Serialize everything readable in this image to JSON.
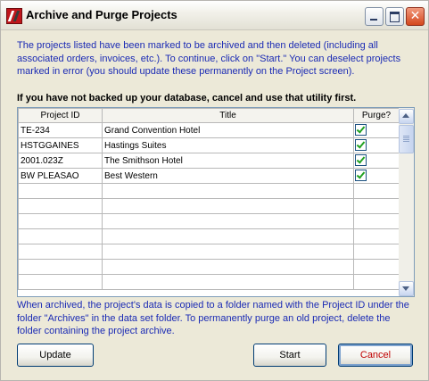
{
  "window": {
    "title": "Archive and Purge Projects"
  },
  "intro_text": "The projects listed have been marked to be archived and then deleted (including all associated orders, invoices, etc.). To continue, click on \"Start.\" You can deselect projects marked in error (you should update these permanently on the Project screen).",
  "warning_text": "If you have not backed up your database, cancel and use that utility first.",
  "grid": {
    "columns": [
      "Project ID",
      "Title",
      "Purge?"
    ],
    "rows": [
      {
        "id": "TE-234",
        "title": "Grand Convention Hotel",
        "purge": true
      },
      {
        "id": "HSTGGAINES",
        "title": "Hastings Suites",
        "purge": true
      },
      {
        "id": "2001.023Z",
        "title": "The Smithson Hotel",
        "purge": true
      },
      {
        "id": "BW PLEASAO",
        "title": "Best Western",
        "purge": true
      }
    ]
  },
  "footer_text": "When archived, the project's data is copied to a folder named with the Project ID under the folder \"Archives\" in the data set folder. To permanently purge an old project, delete the folder containing the project archive.",
  "buttons": {
    "update": "Update",
    "start": "Start",
    "cancel": "Cancel"
  }
}
